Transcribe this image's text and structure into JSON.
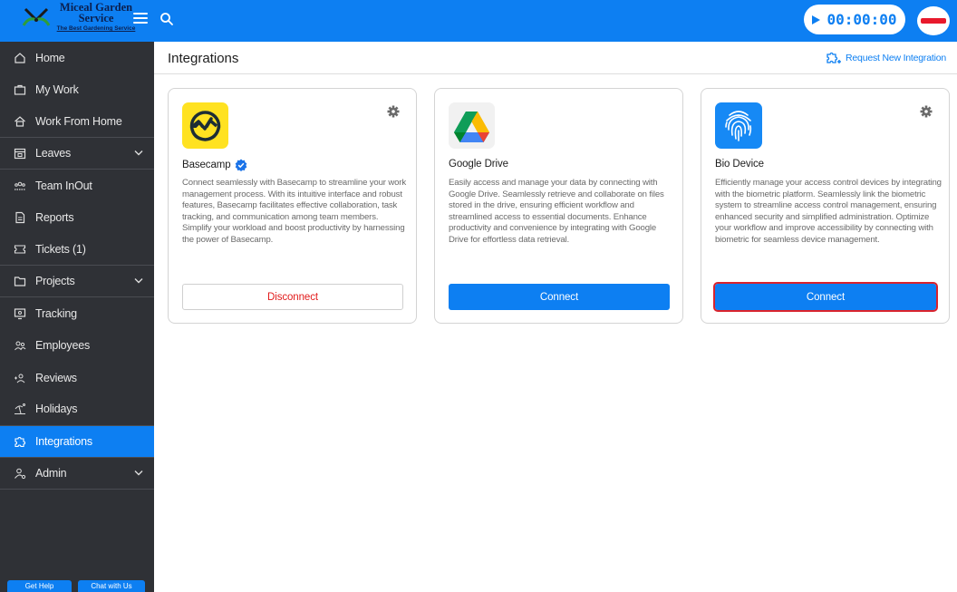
{
  "brand": {
    "name_line1": "Miceal Garden",
    "name_line2": "Service",
    "tagline": "The Best Gardening Service"
  },
  "topbar": {
    "timer": "00:00:00",
    "accent_color": "#0d7ff2"
  },
  "sidebar": {
    "items": [
      {
        "label": "Home",
        "icon": "home-icon"
      },
      {
        "label": "My Work",
        "icon": "briefcase-icon"
      },
      {
        "label": "Work From Home",
        "icon": "house-icon"
      },
      {
        "label": "Leaves",
        "icon": "calendar-icon",
        "expandable": true
      },
      {
        "label": "Team InOut",
        "icon": "team-icon"
      },
      {
        "label": "Reports",
        "icon": "report-icon"
      },
      {
        "label": "Tickets (1)",
        "icon": "ticket-icon"
      },
      {
        "label": "Projects",
        "icon": "folder-icon",
        "expandable": true
      },
      {
        "label": "Tracking",
        "icon": "monitor-icon"
      },
      {
        "label": "Employees",
        "icon": "employees-icon"
      },
      {
        "label": "Reviews",
        "icon": "reviews-icon"
      },
      {
        "label": "Holidays",
        "icon": "beach-icon"
      },
      {
        "label": "Integrations",
        "icon": "puzzle-icon",
        "active": true
      },
      {
        "label": "Admin",
        "icon": "admin-icon",
        "expandable": true
      }
    ],
    "bottom_buttons": [
      "Get Help",
      "Chat with Us"
    ]
  },
  "page": {
    "title": "Integrations",
    "request_link": "Request New Integration"
  },
  "cards": [
    {
      "title": "Basecamp",
      "verified": true,
      "description": "Connect seamlessly with Basecamp to streamline your work management process. With its intuitive interface and robust features, Basecamp facilitates effective collaboration, task tracking, and communication among team members. Simplify your workload and boost productivity by harnessing the power of Basecamp.",
      "button": "Disconnect",
      "has_settings": true
    },
    {
      "title": "Google Drive",
      "verified": false,
      "description": "Easily access and manage your data by connecting with Google Drive. Seamlessly retrieve and collaborate on files stored in the drive, ensuring efficient workflow and streamlined access to essential documents. Enhance productivity and convenience by integrating with Google Drive for effortless data retrieval.",
      "button": "Connect",
      "has_settings": false
    },
    {
      "title": "Bio Device",
      "verified": false,
      "description": "Efficiently manage your access control devices by integrating with the biometric platform. Seamlessly link the biometric system to streamline access control management, ensuring enhanced security and simplified administration. Optimize your workflow and improve accessibility by connecting with biometric for seamless device management.",
      "button": "Connect",
      "has_settings": true
    }
  ]
}
